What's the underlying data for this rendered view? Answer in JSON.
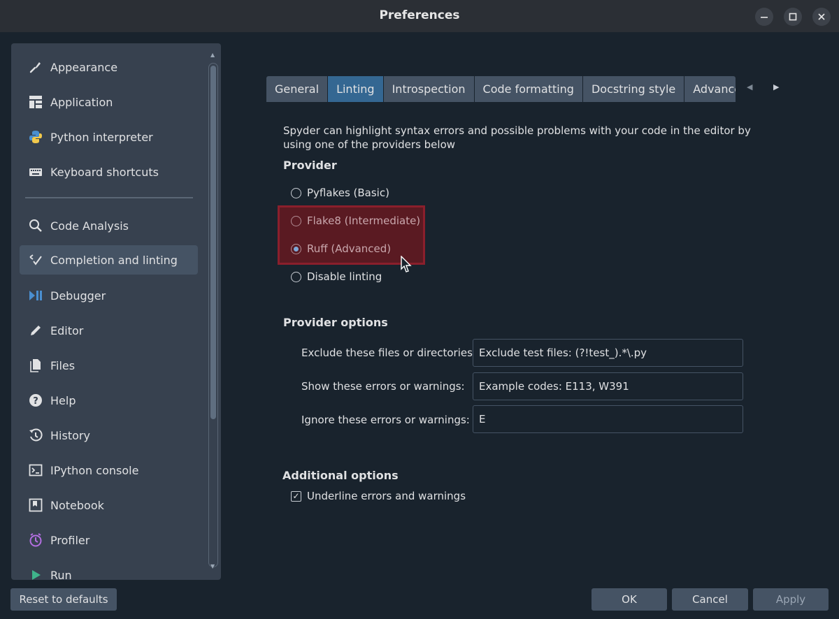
{
  "window": {
    "title": "Preferences"
  },
  "sidebar": {
    "items": [
      {
        "label": "Appearance",
        "icon": "paint-brush-icon"
      },
      {
        "label": "Application",
        "icon": "app-layout-icon"
      },
      {
        "label": "Python interpreter",
        "icon": "python-icon"
      },
      {
        "label": "Keyboard shortcuts",
        "icon": "keyboard-icon"
      },
      {
        "label": "Code Analysis",
        "icon": "code-analysis-icon"
      },
      {
        "label": "Completion and linting",
        "icon": "completion-icon",
        "active": true
      },
      {
        "label": "Debugger",
        "icon": "debugger-icon"
      },
      {
        "label": "Editor",
        "icon": "pencil-icon"
      },
      {
        "label": "Files",
        "icon": "files-icon"
      },
      {
        "label": "Help",
        "icon": "help-icon"
      },
      {
        "label": "History",
        "icon": "history-icon"
      },
      {
        "label": "IPython console",
        "icon": "terminal-icon"
      },
      {
        "label": "Notebook",
        "icon": "notebook-icon"
      },
      {
        "label": "Profiler",
        "icon": "profiler-icon"
      },
      {
        "label": "Run",
        "icon": "run-icon"
      }
    ]
  },
  "tabs": [
    "General",
    "Linting",
    "Introspection",
    "Code formatting",
    "Docstring style",
    "Advance"
  ],
  "active_tab": "Linting",
  "linting": {
    "description": "Spyder can highlight syntax errors and possible problems with your code in the editor by using one of the providers below",
    "provider_title": "Provider",
    "providers": [
      {
        "label": "Pyflakes (Basic)",
        "checked": false
      },
      {
        "label": "Flake8 (Intermediate)",
        "checked": false
      },
      {
        "label": "Ruff (Advanced)",
        "checked": true
      },
      {
        "label": "Disable linting",
        "checked": false
      }
    ],
    "options_title": "Provider options",
    "options": [
      {
        "label": "Exclude these files or directories:",
        "value": "Exclude test files: (?!test_).*\\.py"
      },
      {
        "label": "Show these errors or warnings:",
        "value": "Example codes: E113, W391"
      },
      {
        "label": "Ignore these errors or warnings:",
        "value": "E"
      }
    ],
    "additional_title": "Additional options",
    "underline_label": "Underline errors and warnings",
    "underline_checked": true
  },
  "buttons": {
    "reset": "Reset to defaults",
    "ok": "OK",
    "cancel": "Cancel",
    "apply": "Apply"
  },
  "colors": {
    "background": "#19232d",
    "panel": "#37414f",
    "accent": "#346792",
    "highlight": "#8a1f2c"
  }
}
